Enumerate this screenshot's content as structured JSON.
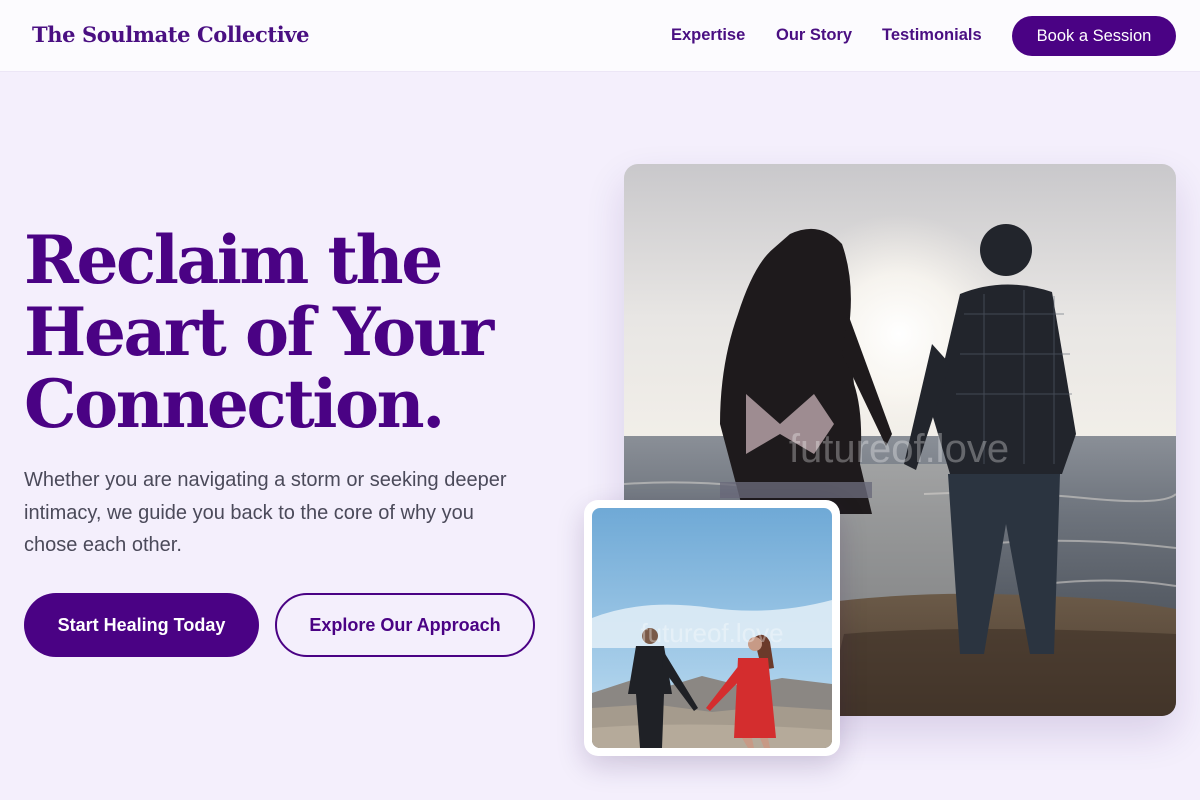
{
  "header": {
    "brand": "The Soulmate Collective",
    "nav": {
      "expertise": "Expertise",
      "story": "Our Story",
      "testimonials": "Testimonials"
    },
    "cta": "Book a Session"
  },
  "hero": {
    "title_lines": [
      "Reclaim the",
      "Heart of Your",
      "Connection."
    ],
    "subtitle": "Whether you are navigating a storm or seeking deeper intimacy, we guide you back to the core of why you chose each other.",
    "primary_cta": "Start Healing Today",
    "secondary_cta": "Explore Our Approach"
  },
  "images": {
    "main_alt": "Couple holding hands watching the sunset over the ocean",
    "small_alt": "Couple holding hands outdoors under a blue sky",
    "watermark": "futureof.love"
  },
  "colors": {
    "brand": "#4a0284",
    "background": "#f4effc",
    "header_bg": "#fcfbfe",
    "body_text": "#4b4a5a"
  }
}
